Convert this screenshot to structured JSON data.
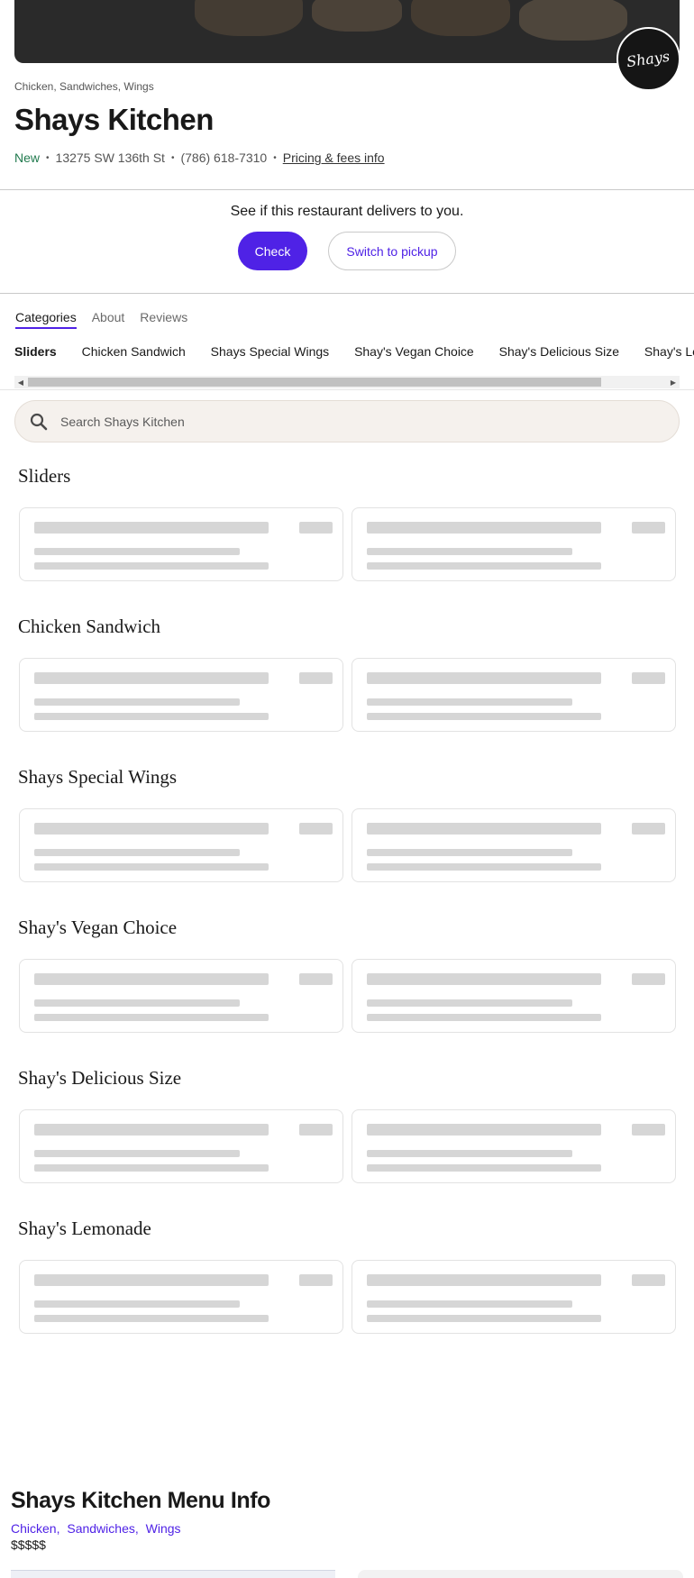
{
  "restaurant": {
    "cuisine_line": "Chicken, Sandwiches, Wings",
    "name": "Shays Kitchen",
    "logo_text": "Shays",
    "status": "New",
    "address": "13275 SW 136th St",
    "phone": "(786) 618-7310",
    "pricing_link": "Pricing & fees info"
  },
  "delivery": {
    "prompt": "See if this restaurant delivers to you.",
    "check_label": "Check",
    "pickup_label": "Switch to pickup"
  },
  "tabs": [
    "Categories",
    "About",
    "Reviews"
  ],
  "category_nav": [
    "Sliders",
    "Chicken Sandwich",
    "Shays Special Wings",
    "Shay's Vegan Choice",
    "Shay's Delicious Size",
    "Shay's Lemonade"
  ],
  "search": {
    "placeholder": "Search Shays Kitchen"
  },
  "sections": [
    {
      "title": "Sliders"
    },
    {
      "title": "Chicken Sandwich"
    },
    {
      "title": "Shays Special Wings"
    },
    {
      "title": "Shay's Vegan Choice"
    },
    {
      "title": "Shay's Delicious Size"
    },
    {
      "title": "Shay's Lemonade"
    }
  ],
  "menu_info": {
    "title": "Shays Kitchen Menu Info",
    "categories": [
      "Chicken,",
      "Sandwiches,",
      "Wings"
    ],
    "price_range": "$$$$$"
  },
  "colors": {
    "accent": "#4f22e6",
    "new_badge": "#217a4e",
    "skeleton": "#d6d6d6",
    "search_bg": "#f5f1ed"
  }
}
